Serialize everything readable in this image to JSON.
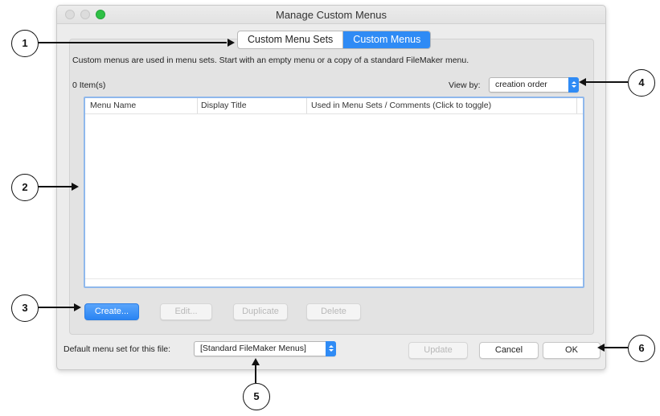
{
  "window": {
    "title": "Manage Custom Menus"
  },
  "tabs": [
    {
      "label": "Custom Menu Sets",
      "active": false
    },
    {
      "label": "Custom Menus",
      "active": true
    }
  ],
  "panel": {
    "info_text": "Custom menus are used in menu sets. Start with an empty menu or a copy of a standard FileMaker menu.",
    "item_count": "0 Item(s)",
    "view_by_label": "View by:",
    "view_by_value": "creation order"
  },
  "table": {
    "columns": [
      "Menu Name",
      "Display Title",
      "Used in Menu Sets / Comments (Click to toggle)"
    ],
    "rows": []
  },
  "buttons": {
    "create": "Create...",
    "edit": "Edit...",
    "duplicate": "Duplicate",
    "delete": "Delete",
    "update": "Update",
    "cancel": "Cancel",
    "ok": "OK"
  },
  "footer": {
    "default_label": "Default menu set for this file:",
    "default_value": "[Standard FileMaker Menus]"
  },
  "callouts": [
    "1",
    "2",
    "3",
    "4",
    "5",
    "6"
  ],
  "colors": {
    "accent": "#2f8bf5",
    "window_bg": "#ececec",
    "zoom_button": "#2ec045"
  }
}
